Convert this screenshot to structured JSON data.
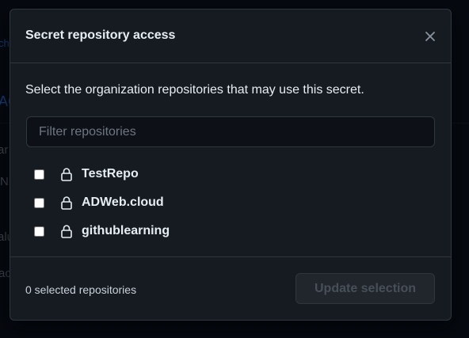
{
  "background_fragments": [
    {
      "id": "bg-1",
      "text": "ch"
    },
    {
      "id": "bg-2",
      "text": "AC"
    },
    {
      "id": "bg-3",
      "text": "ar"
    },
    {
      "id": "bg-4",
      "text": "N"
    },
    {
      "id": "bg-5",
      "text": "alu"
    },
    {
      "id": "bg-6",
      "text": "ac"
    }
  ],
  "dialog": {
    "title": "Secret repository access",
    "close_icon": "close-icon",
    "description": "Select the organization repositories that may use this secret.",
    "filter": {
      "placeholder": "Filter repositories",
      "value": ""
    },
    "repositories": [
      {
        "name": "TestRepo",
        "checked": false,
        "icon": "lock-icon"
      },
      {
        "name": "ADWeb.cloud",
        "checked": false,
        "icon": "lock-icon"
      },
      {
        "name": "githublearning",
        "checked": false,
        "icon": "lock-icon"
      }
    ],
    "footer": {
      "selected_count_text": "0 selected repositories",
      "update_button_label": "Update selection",
      "update_button_disabled": true
    }
  },
  "colors": {
    "background": "#0d1117",
    "dialog_bg": "#161b22",
    "border": "#30363d",
    "text": "#e6edf3",
    "muted": "#6e7681",
    "link": "#2f81f7"
  }
}
